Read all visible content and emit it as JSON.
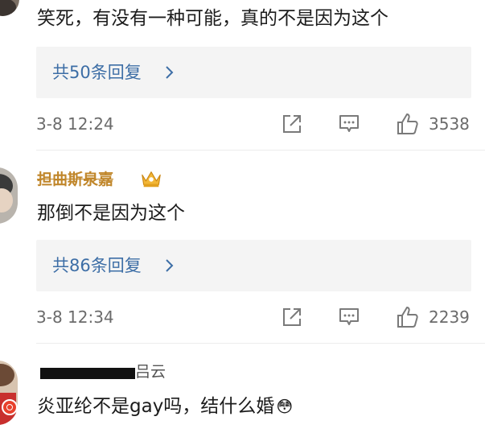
{
  "comments": [
    {
      "text": "笑死，有没有一种可能，真的不是因为这个",
      "replies_label": "共50条回复",
      "timestamp": "3-8 12:24",
      "likes": "3538"
    },
    {
      "username": "担曲斯泉嘉",
      "text": "那倒不是因为这个",
      "replies_label": "共86条回复",
      "timestamp": "3-8 12:34",
      "likes": "2239"
    },
    {
      "username_visible": "吕云",
      "text": "炎亚纶不是gay吗，结什么婚",
      "emoji": "😳"
    }
  ],
  "icons": {
    "share": "share-icon",
    "comment": "comment-icon",
    "like": "thumbs-up-icon",
    "chevron": "chevron-right-icon",
    "crown": "crown-badge-icon"
  },
  "colors": {
    "link_blue": "#3d6ea6",
    "username_gold": "#c0862a",
    "meta_gray": "#6b6b6b",
    "reply_bg": "#f4f4f4"
  }
}
